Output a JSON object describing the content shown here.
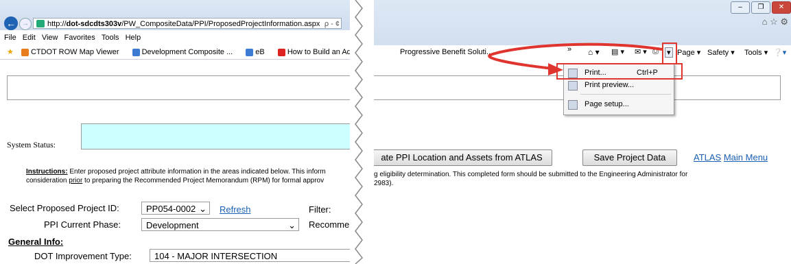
{
  "browser": {
    "url_prefix": "http://",
    "url_host": "dot-sdcdts303v",
    "url_path": "/PW_CompositeData/PPI/ProposedProjectInformation.aspx",
    "search_glyph": "ρ - ¢",
    "menu": [
      "File",
      "Edit",
      "View",
      "Favorites",
      "Tools",
      "Help"
    ],
    "favorites": [
      "CTDOT ROW Map Viewer",
      "Development Composite ...",
      "eB",
      "How to Build an Advance..."
    ],
    "favorite_tab": "Progressive Benefit Soluti...",
    "chevron": "»"
  },
  "command_bar": {
    "page": "Page",
    "safety": "Safety",
    "tools": "Tools"
  },
  "print_menu": {
    "items": [
      {
        "label": "Print...",
        "shortcut": "Ctrl+P"
      },
      {
        "label": "Print preview...",
        "shortcut": ""
      },
      {
        "label": "Page setup...",
        "shortcut": ""
      }
    ]
  },
  "form": {
    "system_status_label": "System Status:",
    "instructions_lead": "Instructions:",
    "instructions_left": " Enter proposed project attribute information in the areas indicated below. This inform",
    "instructions_left2": "consideration ",
    "instructions_prior": "prior",
    "instructions_left3": " to preparing the Recommended Project Memorandum (RPM) for formal approv",
    "instructions_right": "g eligibility determination. This completed form should be submitted to the Engineering Administrator for",
    "instructions_right2": "2983).",
    "select_label": "Select Proposed Project ID:",
    "project_id": "PP054-0002",
    "refresh": "Refresh",
    "filter_label": "Filter:",
    "phase_label": "PPI Current Phase:",
    "phase_value": "Development",
    "recommend_label": "Recommei",
    "general_info": "General Info:",
    "improvement_label": "DOT Improvement Type:",
    "improvement_value": "104 - MAJOR INTERSECTION",
    "atlas_button": "ate PPI Location and Assets from ATLAS",
    "save_button": "Save Project Data",
    "atlas_link": "ATLAS",
    "main_menu_link": "Main Menu"
  },
  "colors": {
    "annotation": "#e0342f",
    "system_status_bg": "#ccffff",
    "link": "#1a5fb4"
  }
}
